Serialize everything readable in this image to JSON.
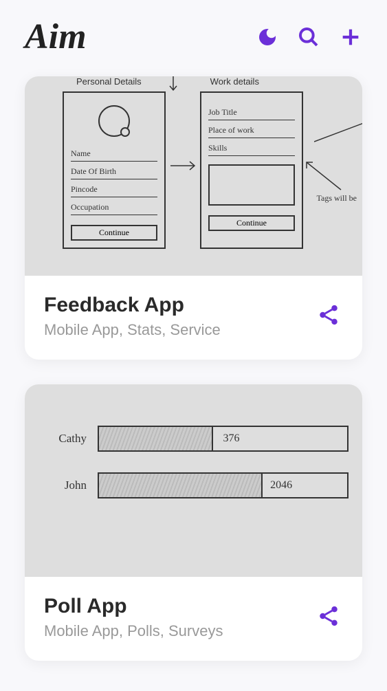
{
  "app": {
    "logo": "Aim"
  },
  "colors": {
    "accent": "#6B2FD8"
  },
  "cards": [
    {
      "title": "Feedback App",
      "subtitle": "Mobile App, Stats, Service",
      "sketch": {
        "panel1": {
          "header": "Personal Details",
          "fields": [
            "Name",
            "Date Of Birth",
            "Pincode",
            "Occupation"
          ],
          "button": "Continue"
        },
        "panel2": {
          "header": "Work details",
          "fields": [
            "Job Title",
            "Place of work",
            "Skills"
          ],
          "button": "Continue"
        },
        "note": "Tags will be"
      }
    },
    {
      "title": "Poll App",
      "subtitle": "Mobile App, Polls, Surveys",
      "poll": {
        "rows": [
          {
            "name": "Cathy",
            "value": "376",
            "fillPercent": 46
          },
          {
            "name": "John",
            "value": "2046",
            "fillPercent": 66
          }
        ]
      }
    }
  ]
}
